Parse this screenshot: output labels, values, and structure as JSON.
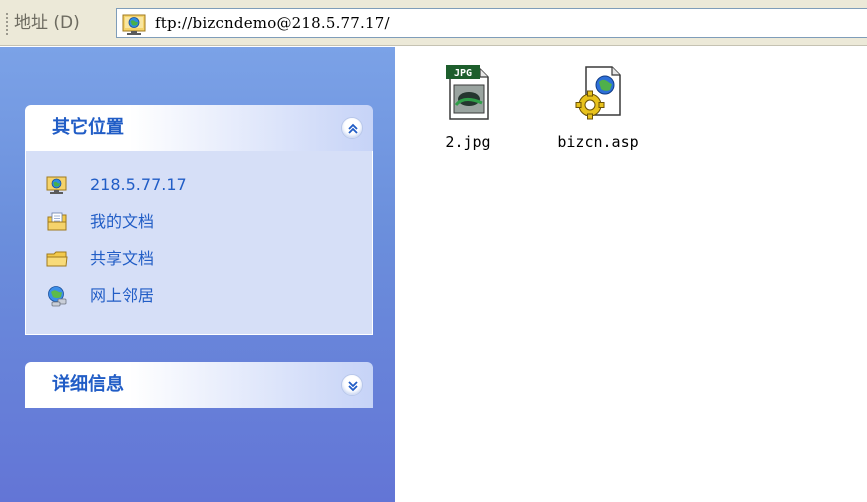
{
  "address_bar": {
    "label": "地址 (D)",
    "value": "ftp://bizcndemo@218.5.77.17/",
    "icon": "ftp-folder-icon"
  },
  "other_places": {
    "title": "其它位置",
    "toggle_icon": "chevron-up-icon",
    "items": [
      {
        "label": "218.5.77.17",
        "icon": "ftp-folder-icon"
      },
      {
        "label": "我的文档",
        "icon": "my-documents-icon"
      },
      {
        "label": "共享文档",
        "icon": "folder-icon"
      },
      {
        "label": "网上邻居",
        "icon": "network-icon"
      }
    ]
  },
  "details": {
    "title": "详细信息",
    "toggle_icon": "chevron-down-icon"
  },
  "files": [
    {
      "name": "2.jpg",
      "icon": "jpg-file-icon",
      "badge": "JPG"
    },
    {
      "name": "bizcn.asp",
      "icon": "asp-file-icon"
    }
  ],
  "colors": {
    "task_pane_top": "#7ba2e7",
    "task_pane_bottom": "#6375d6",
    "panel_title": "#215dc6",
    "panel_body": "#d6dff7",
    "link": "#215dc6"
  }
}
